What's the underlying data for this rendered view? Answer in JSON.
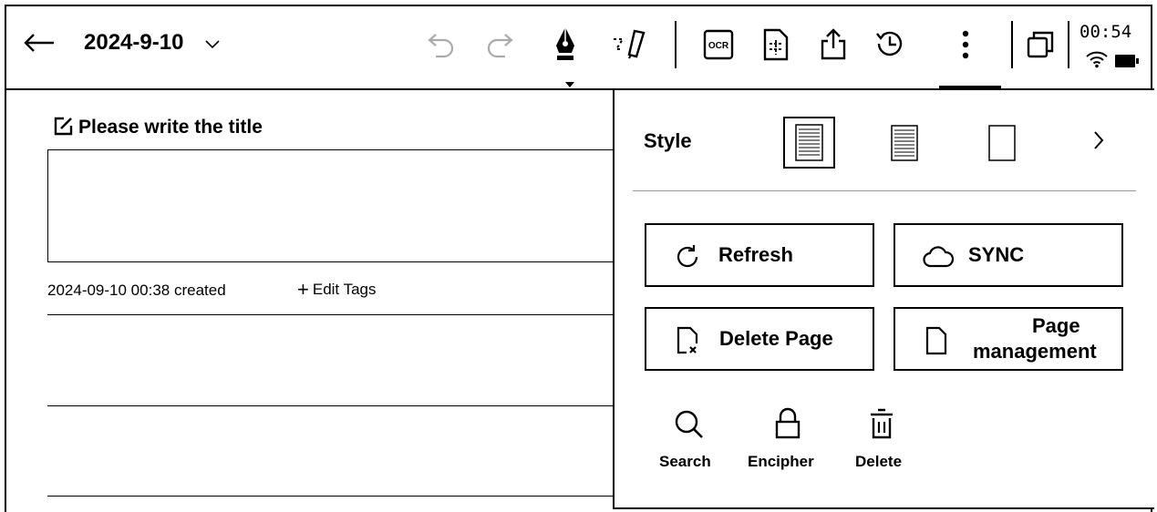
{
  "topbar": {
    "title": "2024-9-10",
    "clock": "00:54",
    "icons": [
      "back-arrow-icon",
      "chevron-down-icon",
      "undo-icon",
      "redo-icon",
      "pen-nib-icon",
      "lasso-icon",
      "ocr-icon",
      "page-layout-icon",
      "share-icon",
      "history-icon",
      "more-icon",
      "window-icon",
      "wifi-icon",
      "battery-icon"
    ],
    "ocr_label": "OCR"
  },
  "note": {
    "title_placeholder": "Please write the title",
    "created": "2024-09-10 00:38 created",
    "edit_tags_label": "Edit Tags"
  },
  "menu": {
    "style_label": "Style",
    "buttons": [
      {
        "label": "Refresh",
        "icon": "refresh-icon"
      },
      {
        "label": "SYNC",
        "icon": "cloud-icon"
      },
      {
        "label": "Delete Page",
        "icon": "delete-page-icon"
      },
      {
        "label_line1": "Page",
        "label_line2": "management",
        "icon": "page-icon"
      }
    ],
    "tools": [
      {
        "label": "Search",
        "icon": "search-icon"
      },
      {
        "label": "Encipher",
        "icon": "lock-icon"
      },
      {
        "label": "Delete",
        "icon": "trash-icon"
      }
    ]
  }
}
